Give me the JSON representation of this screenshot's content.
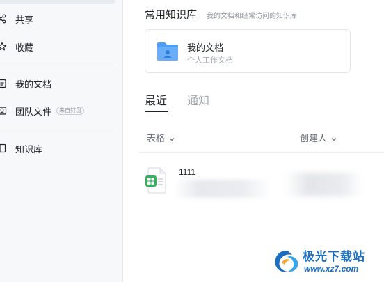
{
  "sidebar": {
    "items": [
      {
        "label": "共享",
        "icon": "share-icon"
      },
      {
        "label": "收藏",
        "icon": "star-icon"
      },
      {
        "label": "我的文档",
        "icon": "document-icon"
      },
      {
        "label": "团队文件",
        "icon": "team-icon",
        "badge": "来自钉盘"
      },
      {
        "label": "知识库",
        "icon": "book-icon"
      }
    ]
  },
  "main": {
    "section_title": "常用知识库",
    "section_subtitle": "我的文档和经常访问的知识库",
    "knowledge_base": {
      "title": "我的文档",
      "description": "个人工作文档",
      "icon": "folder-icon"
    },
    "tabs": [
      {
        "label": "最近",
        "active": true
      },
      {
        "label": "通知",
        "active": false
      }
    ],
    "columns": {
      "type": "表格",
      "creator": "创建人"
    },
    "files": [
      {
        "name": "1111",
        "icon": "spreadsheet-icon"
      }
    ]
  },
  "watermark": {
    "name": "极光下载站",
    "url": "www.xz7.com"
  },
  "colors": {
    "folder": "#4d9ef5",
    "spreadsheet": "#2fb45a",
    "watermark": "#1a6fc0"
  }
}
